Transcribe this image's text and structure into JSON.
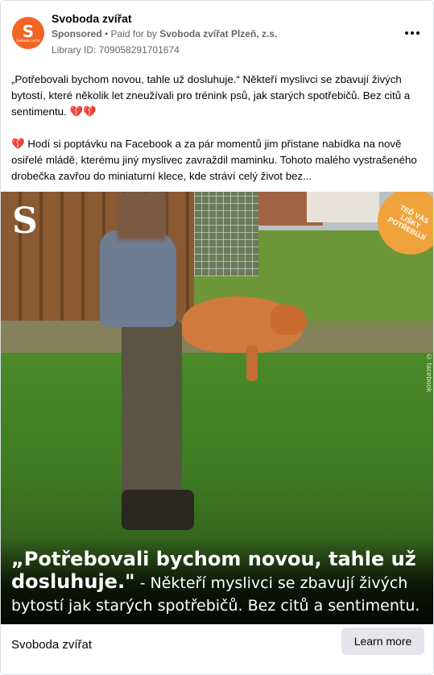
{
  "header": {
    "page_name": "Svoboda zvířat",
    "sponsored_label": "Sponsored",
    "paid_prefix": " • Paid for by ",
    "paid_by": "Svoboda zvířat Plzeň, z.s.",
    "library_id": "Library ID: 709058291701674",
    "avatar_letter": "S",
    "avatar_subtext": "Svoboda zvířat"
  },
  "post": {
    "paragraph1": "„Potřebovali bychom novou, tahle už dosluhuje.“ Někteří myslivci se zbavují živých bytostí, které několik let zneužívali pro trénink psů, jak starých spotřebičů. Bez citů a sentimentu. ",
    "paragraph1_hearts": "💔💔",
    "paragraph2_heart": "💔 ",
    "paragraph2": "Hodí si poptávku na Facebook a za pár momentů jim přistane nabídka na nově osiřelé mládě, kterému jiný myslivec zavraždil maminku. Tohoto malého vystrašeného drobečka zavřou do miniaturní klece, kde stráví celý život bez..."
  },
  "image": {
    "logo_letter": "S",
    "badge_text": "TEĎ VÁS LIŠKY POTŘEBUJÍ",
    "watermark": "© facebook",
    "caption_quote": "„Potřebovali bychom novou, tahle už dosluhuje.\"",
    "caption_rest": " - Někteří myslivci se zbavují živých bytostí jak starých spotřebičů. Bez citů a sentimentu."
  },
  "footer": {
    "name": "Svoboda zvířat",
    "cta_label": "Learn more"
  },
  "colors": {
    "brand_orange": "#f26522",
    "badge_orange": "#f0a33a",
    "secondary_text": "#65676b",
    "button_bg": "#e4e6eb"
  },
  "icons": {
    "more": "more-options-icon",
    "heart": "broken-heart-icon"
  }
}
